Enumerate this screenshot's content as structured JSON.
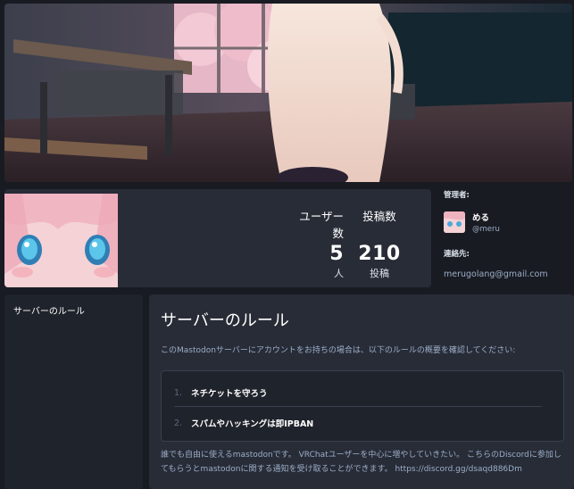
{
  "stats": {
    "users_label": "ユーザー数",
    "users_value": "5",
    "users_unit": "人",
    "posts_label": "投稿数",
    "posts_value": "210",
    "posts_unit": "投稿"
  },
  "admin": {
    "heading": "管理者:",
    "display_name": "める",
    "username": "@meru"
  },
  "contact": {
    "heading": "連絡先:",
    "email": "merugolang@gmail.com"
  },
  "nav": {
    "items": [
      {
        "label": "サーバーのルール"
      }
    ]
  },
  "rules_panel": {
    "title": "サーバーのルール",
    "lead": "このMastodonサーバーにアカウントをお持ちの場合は、以下のルールの概要を確認してください:",
    "rules": [
      {
        "num": "1.",
        "text": "ネチケットを守ろう"
      },
      {
        "num": "2.",
        "text": "スパムやハッキングは即IPBAN"
      }
    ],
    "description": "誰でも自由に使えるmastodonです。 VRChatユーザーを中心に増やしていきたい。 こちらのDiscordに参加してもらうとmastodonに関する通知を受け取ることができます。 https://discord.gg/dsaqd886Dm"
  }
}
